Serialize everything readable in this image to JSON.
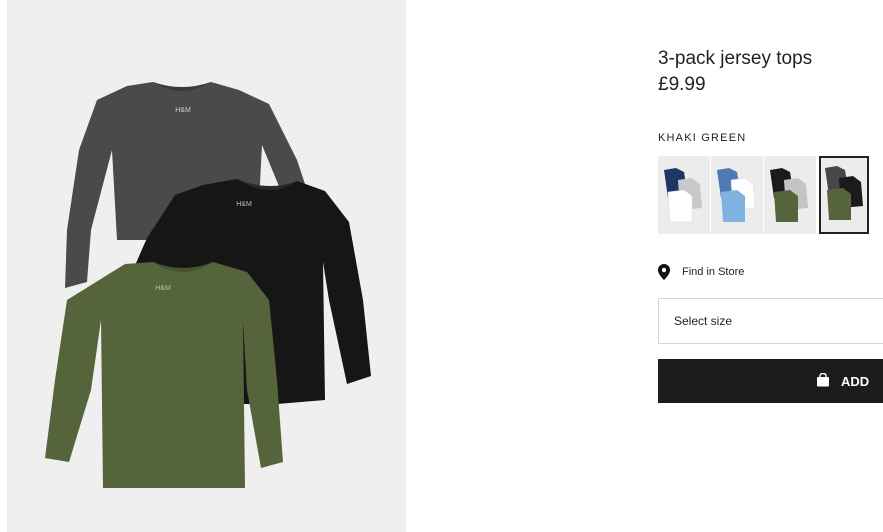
{
  "product": {
    "title": "3-pack jersey tops",
    "price": "£9.99",
    "image_logo_text": "H&M"
  },
  "color": {
    "selected_label": "KHAKI GREEN",
    "swatches": [
      {
        "name": "dark-blue-grey-white",
        "colors": [
          "#1f3563",
          "#c9c9c9",
          "#ffffff"
        ]
      },
      {
        "name": "blue-white-lightblue",
        "colors": [
          "#4f79b3",
          "#ffffff",
          "#7fb4e0"
        ]
      },
      {
        "name": "black-grey-khaki",
        "colors": [
          "#1b1b1b",
          "#c4c4c4",
          "#55643a"
        ]
      },
      {
        "name": "dark-grey-black-khaki",
        "colors": [
          "#474747",
          "#1b1b1b",
          "#55643a"
        ]
      }
    ]
  },
  "store": {
    "find_label": "Find in Store"
  },
  "size": {
    "placeholder": "Select size"
  },
  "cart": {
    "add_label": "ADD"
  },
  "colors": {
    "button_bg": "#1c1c1c",
    "image_bg": "#efefef"
  }
}
